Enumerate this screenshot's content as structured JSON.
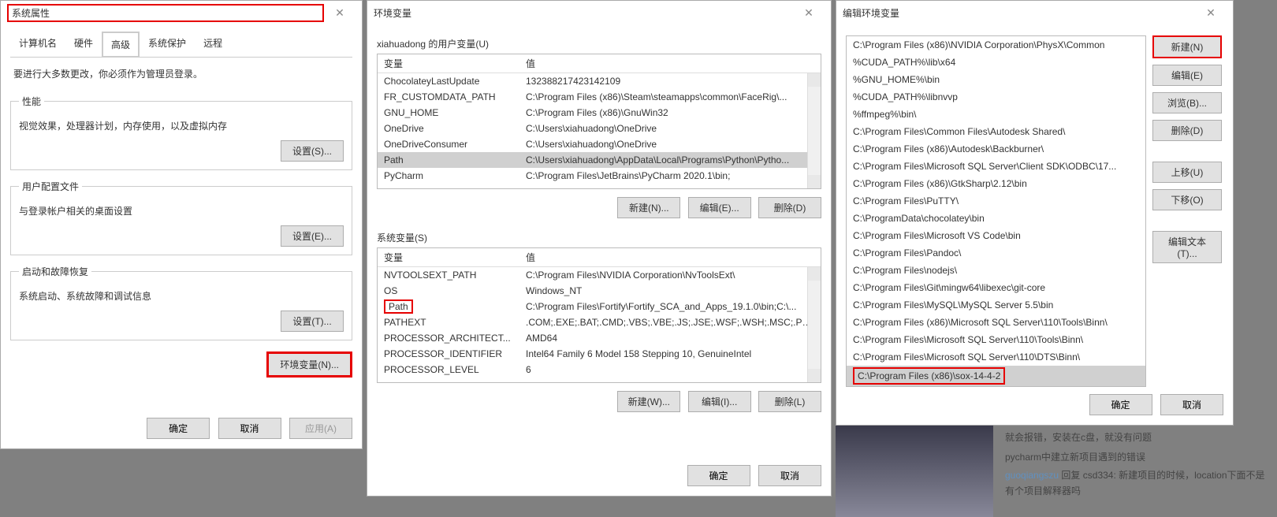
{
  "colors": {
    "highlight": "#e60000"
  },
  "dialog1": {
    "title": "系统属性",
    "tabs": [
      "计算机名",
      "硬件",
      "高级",
      "系统保护",
      "远程"
    ],
    "active_tab": "高级",
    "hint": "要进行大多数更改，你必须作为管理员登录。",
    "sections": {
      "perf": {
        "legend": "性能",
        "desc": "视觉效果，处理器计划，内存使用，以及虚拟内存",
        "btn": "设置(S)..."
      },
      "profile": {
        "legend": "用户配置文件",
        "desc": "与登录帐户相关的桌面设置",
        "btn": "设置(E)..."
      },
      "startup": {
        "legend": "启动和故障恢复",
        "desc": "系统启动、系统故障和调试信息",
        "btn": "设置(T)..."
      }
    },
    "env_btn": "环境变量(N)...",
    "footer": {
      "ok": "确定",
      "cancel": "取消",
      "apply": "应用(A)"
    }
  },
  "dialog2": {
    "title": "环境变量",
    "user_label": "xiahuadong 的用户变量(U)",
    "sys_label": "系统变量(S)",
    "headers": {
      "var": "变量",
      "val": "值"
    },
    "user_vars": [
      {
        "k": "ChocolateyLastUpdate",
        "v": "132388217423142109"
      },
      {
        "k": "FR_CUSTOMDATA_PATH",
        "v": "C:\\Program Files (x86)\\Steam\\steamapps\\common\\FaceRig\\..."
      },
      {
        "k": "GNU_HOME",
        "v": "C:\\Program Files (x86)\\GnuWin32"
      },
      {
        "k": "OneDrive",
        "v": "C:\\Users\\xiahuadong\\OneDrive"
      },
      {
        "k": "OneDriveConsumer",
        "v": "C:\\Users\\xiahuadong\\OneDrive"
      },
      {
        "k": "Path",
        "v": "C:\\Users\\xiahuadong\\AppData\\Local\\Programs\\Python\\Pytho..."
      },
      {
        "k": "PyCharm",
        "v": "C:\\Program Files\\JetBrains\\PyCharm 2020.1\\bin;"
      }
    ],
    "user_selected": 5,
    "sys_vars": [
      {
        "k": "NVTOOLSEXT_PATH",
        "v": "C:\\Program Files\\NVIDIA Corporation\\NvToolsExt\\"
      },
      {
        "k": "OS",
        "v": "Windows_NT"
      },
      {
        "k": "Path",
        "v": "C:\\Program Files\\Fortify\\Fortify_SCA_and_Apps_19.1.0\\bin;C:\\..."
      },
      {
        "k": "PATHEXT",
        "v": ".COM;.EXE;.BAT;.CMD;.VBS;.VBE;.JS;.JSE;.WSF;.WSH;.MSC;.PY;.P..."
      },
      {
        "k": "PROCESSOR_ARCHITECT...",
        "v": "AMD64"
      },
      {
        "k": "PROCESSOR_IDENTIFIER",
        "v": "Intel64 Family 6 Model 158 Stepping 10, GenuineIntel"
      },
      {
        "k": "PROCESSOR_LEVEL",
        "v": "6"
      }
    ],
    "sys_highlight": 2,
    "btns": {
      "new_u": "新建(N)...",
      "edit_u": "编辑(E)...",
      "del_u": "删除(D)",
      "new_s": "新建(W)...",
      "edit_s": "编辑(I)...",
      "del_s": "删除(L)",
      "ok": "确定",
      "cancel": "取消"
    }
  },
  "dialog3": {
    "title": "编辑环境变量",
    "paths": [
      "C:\\Program Files (x86)\\NVIDIA Corporation\\PhysX\\Common",
      "%CUDA_PATH%\\lib\\x64",
      "%GNU_HOME%\\bin",
      "%CUDA_PATH%\\libnvvp",
      "%ffmpeg%\\bin\\",
      "C:\\Program Files\\Common Files\\Autodesk Shared\\",
      "C:\\Program Files (x86)\\Autodesk\\Backburner\\",
      "C:\\Program Files\\Microsoft SQL Server\\Client SDK\\ODBC\\17...",
      "C:\\Program Files (x86)\\GtkSharp\\2.12\\bin",
      "C:\\Program Files\\PuTTY\\",
      "C:\\ProgramData\\chocolatey\\bin",
      "C:\\Program Files\\Microsoft VS Code\\bin",
      "C:\\Program Files\\Pandoc\\",
      "C:\\Program Files\\nodejs\\",
      "C:\\Program Files\\Git\\mingw64\\libexec\\git-core",
      "C:\\Program Files\\MySQL\\MySQL Server 5.5\\bin",
      "C:\\Program Files (x86)\\Microsoft SQL Server\\110\\Tools\\Binn\\",
      "C:\\Program Files\\Microsoft SQL Server\\110\\Tools\\Binn\\",
      "C:\\Program Files\\Microsoft SQL Server\\110\\DTS\\Binn\\",
      "C:\\Program Files (x86)\\sox-14-4-2"
    ],
    "selected": 19,
    "side": {
      "new": "新建(N)",
      "edit": "编辑(E)",
      "browse": "浏览(B)...",
      "del": "删除(D)",
      "up": "上移(U)",
      "down": "下移(O)",
      "edit_text": "编辑文本(T)..."
    },
    "footer": {
      "ok": "确定",
      "cancel": "取消"
    }
  },
  "comments": {
    "c1": "就会报错，安装在c盘，就没有问题",
    "c2": "pycharm中建立新项目遇到的错误",
    "author": "guoqiangszu",
    "reply_to": "csd334",
    "reply_label": "回复",
    "c3": "新建项目的时候，location下面不是有个项目解释器吗"
  }
}
